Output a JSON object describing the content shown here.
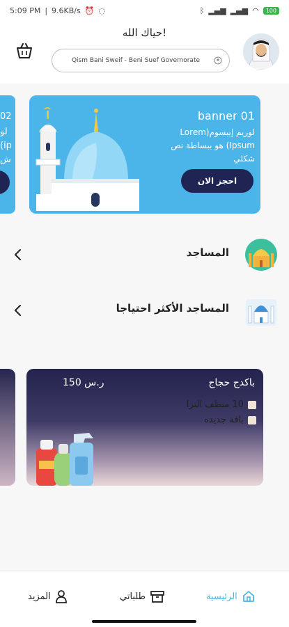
{
  "status_bar": {
    "time": "5:09 PM",
    "network_speed": "9.6KB/s",
    "battery": "100"
  },
  "header": {
    "greeting": "حياك الله!",
    "location": "Qism Bani Sweif - Beni Suef Governorate"
  },
  "banners": {
    "partial_title": "02",
    "partial_text": [
      "لو",
      "(ip",
      "ش"
    ],
    "main": {
      "title": "banner 01",
      "text": "لوريم إيبسوم(Lorem Ipsum) هو ببساطة نص شكلي",
      "button": "احجز الان"
    }
  },
  "sections": [
    {
      "label": "المساجد",
      "icon": "mosque-dome-icon"
    },
    {
      "label": "المساجد الأكثر احتياجا",
      "icon": "mosque-blue-icon"
    }
  ],
  "package_card": {
    "title": "باكدج حجاج",
    "price": "150 ر.س",
    "items": [
      "10 منظف التزا",
      "باقة جديده"
    ]
  },
  "bottom_nav": {
    "home": "الرئيسية",
    "orders": "طلباتي",
    "more": "المزيد"
  },
  "colors": {
    "accent": "#4bb4e8",
    "dark": "#1f2453",
    "active_nav": "#4bb4e8"
  }
}
